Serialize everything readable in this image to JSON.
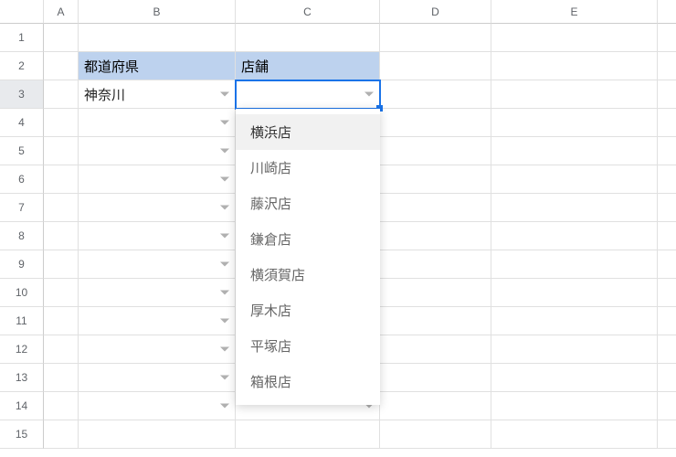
{
  "columns": [
    "A",
    "B",
    "C",
    "D",
    "E",
    ""
  ],
  "rowCount": 15,
  "activeRow": 3,
  "selectedCell": "C3",
  "cells": {
    "B2": {
      "value": "都道府県",
      "style": "header"
    },
    "C2": {
      "value": "店舗",
      "style": "header"
    },
    "B3": {
      "value": "神奈川",
      "dv": true
    },
    "C3": {
      "value": "",
      "dv": true,
      "selected": true
    },
    "B4": {
      "value": "",
      "dv": true
    },
    "C4": {
      "value": "",
      "dv": true
    },
    "B5": {
      "value": "",
      "dv": true
    },
    "C5": {
      "value": "",
      "dv": true
    },
    "B6": {
      "value": "",
      "dv": true
    },
    "C6": {
      "value": "",
      "dv": true
    },
    "B7": {
      "value": "",
      "dv": true
    },
    "C7": {
      "value": "",
      "dv": true
    },
    "B8": {
      "value": "",
      "dv": true
    },
    "C8": {
      "value": "",
      "dv": true
    },
    "B9": {
      "value": "",
      "dv": true
    },
    "C9": {
      "value": "",
      "dv": true
    },
    "B10": {
      "value": "",
      "dv": true
    },
    "C10": {
      "value": "",
      "dv": true
    },
    "B11": {
      "value": "",
      "dv": true
    },
    "C11": {
      "value": "",
      "dv": true
    },
    "B12": {
      "value": "",
      "dv": true
    },
    "C12": {
      "value": "",
      "dv": true
    },
    "B13": {
      "value": "",
      "dv": true
    },
    "C13": {
      "value": "",
      "dv": true
    },
    "B14": {
      "value": "",
      "dv": true
    },
    "C14": {
      "value": "",
      "dv": true
    }
  },
  "dropdown": {
    "visible": true,
    "highlighted": 0,
    "options": [
      "横浜店",
      "川崎店",
      "藤沢店",
      "鎌倉店",
      "横須賀店",
      "厚木店",
      "平塚店",
      "箱根店"
    ]
  }
}
